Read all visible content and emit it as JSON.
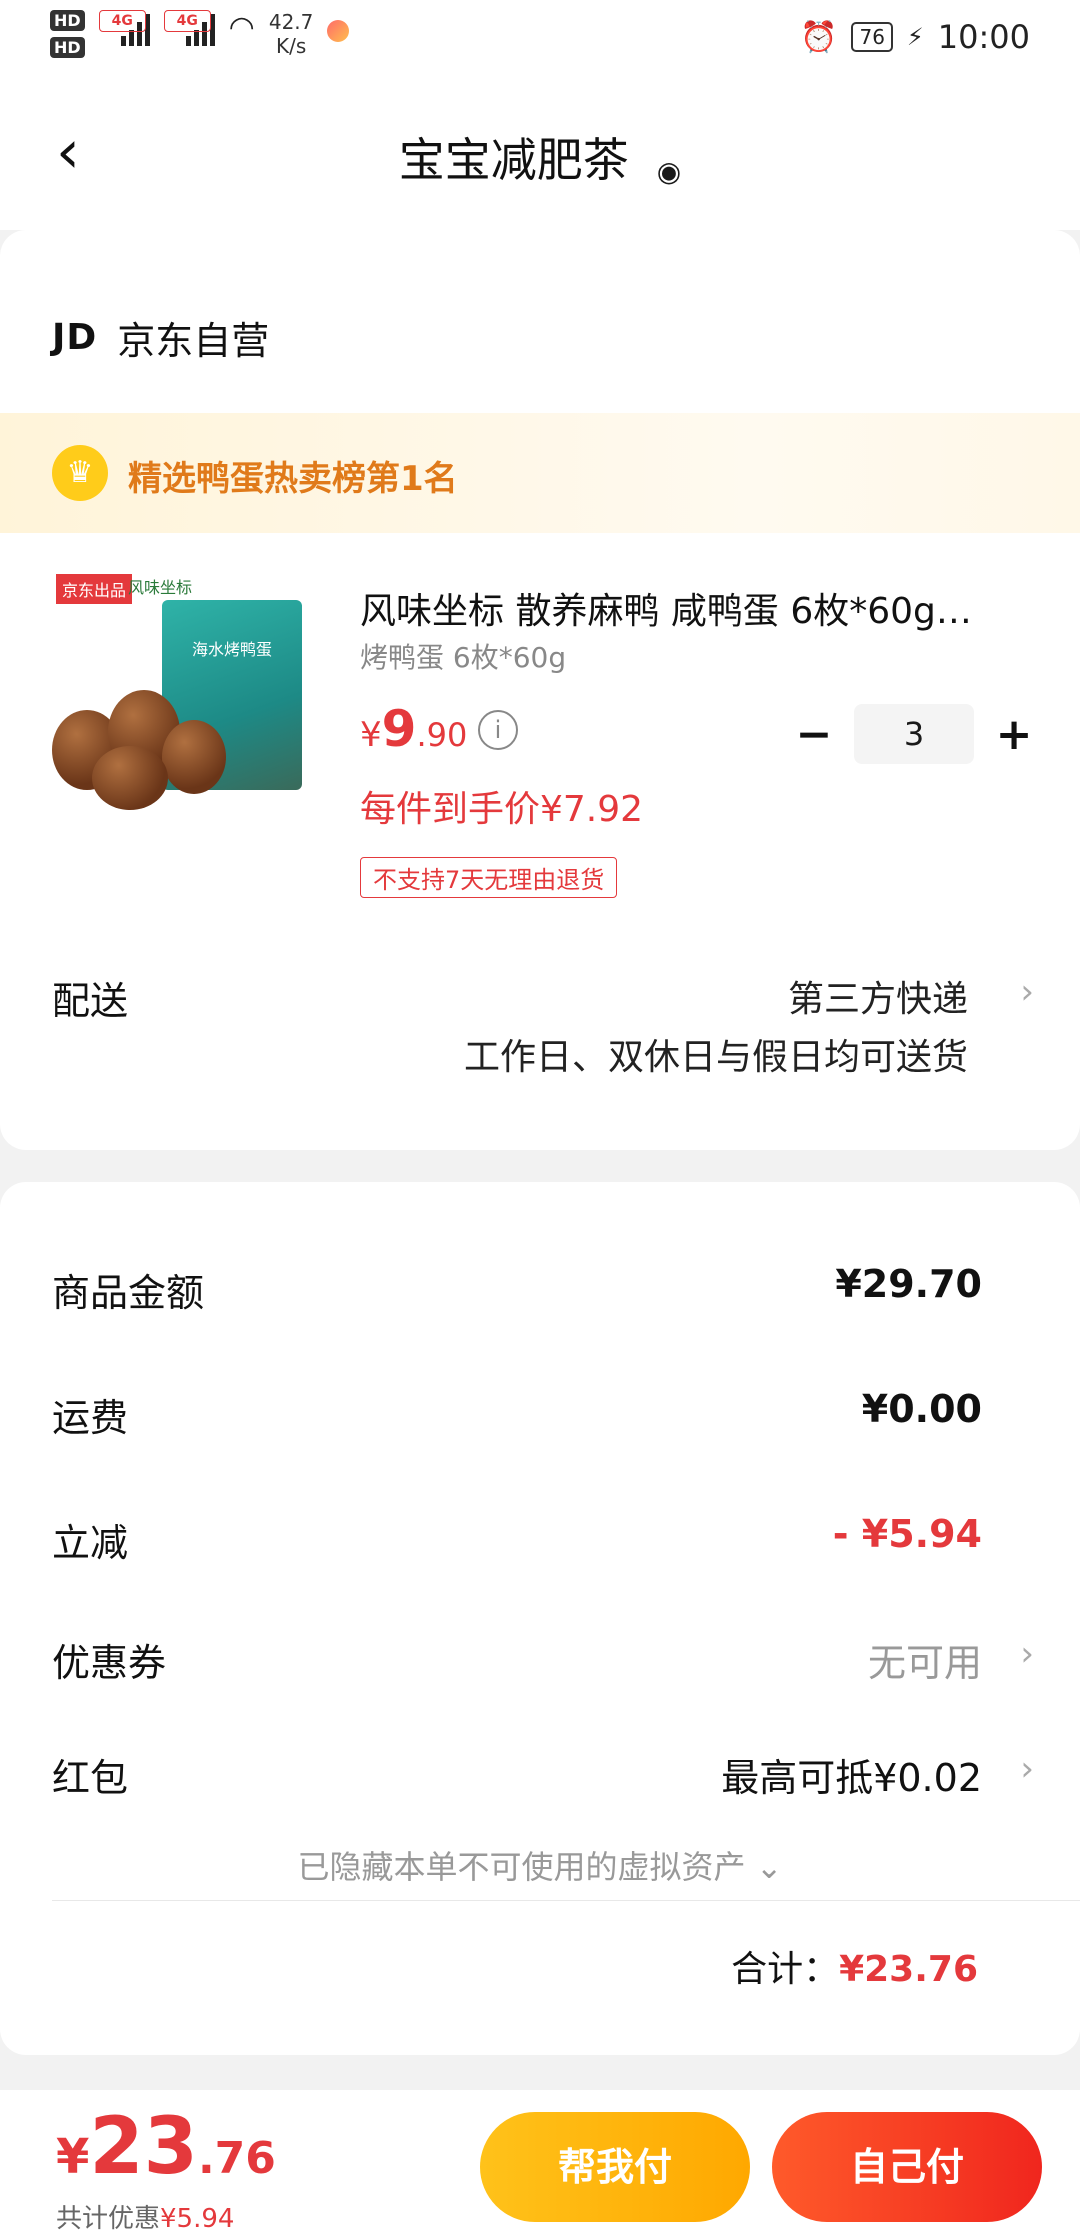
{
  "status_bar": {
    "hd1": "HD",
    "hd2": "HD",
    "net1": "4G",
    "net2": "4G",
    "speed_value": "42.7",
    "speed_unit": "K/s",
    "battery": "76",
    "time": "10:00"
  },
  "header": {
    "title": "宝宝减肥茶"
  },
  "shop": {
    "badge": "JD",
    "name": "京东自营"
  },
  "rank_banner": {
    "text": "精选鸭蛋热卖榜第1名"
  },
  "product": {
    "thumb_logo1": "京东出品",
    "thumb_logo2": "风味坐标",
    "thumb_box_text": "海水烤鸭蛋",
    "name": "风味坐标 散养麻鸭 咸鸭蛋 6枚*60g…",
    "spec": "烤鸭蛋 6枚*60g",
    "price_symbol": "¥",
    "price_int": "9",
    "price_dec": ".90",
    "each_price": "每件到手价¥7.92",
    "tag": "不支持7天无理由退货",
    "quantity": "3"
  },
  "delivery": {
    "label": "配送",
    "method": "第三方快递",
    "note": "工作日、双休日与假日均可送货"
  },
  "summary": {
    "goods_label": "商品金额",
    "goods_value": "¥29.70",
    "freight_label": "运费",
    "freight_value": "¥0.00",
    "discount_label": "立减",
    "discount_value": "- ¥5.94",
    "coupon_label": "优惠券",
    "coupon_value": "无可用",
    "redpacket_label": "红包",
    "redpacket_value": "最高可抵¥0.02",
    "hidden_assets": "已隐藏本单不可使用的虚拟资产",
    "total_label": "合计：",
    "total_value": "¥23.76"
  },
  "bottom_bar": {
    "price_symbol": "¥",
    "price_int": "23",
    "price_dec": ".76",
    "discount_label": "共计优惠",
    "discount_value": "¥5.94",
    "help_pay": "帮我付",
    "self_pay": "自己付"
  },
  "colors": {
    "accent_red": "#e4393c",
    "rank_orange": "#e07a1a",
    "help_btn": "#ffb400",
    "self_btn": "#f0261e"
  }
}
